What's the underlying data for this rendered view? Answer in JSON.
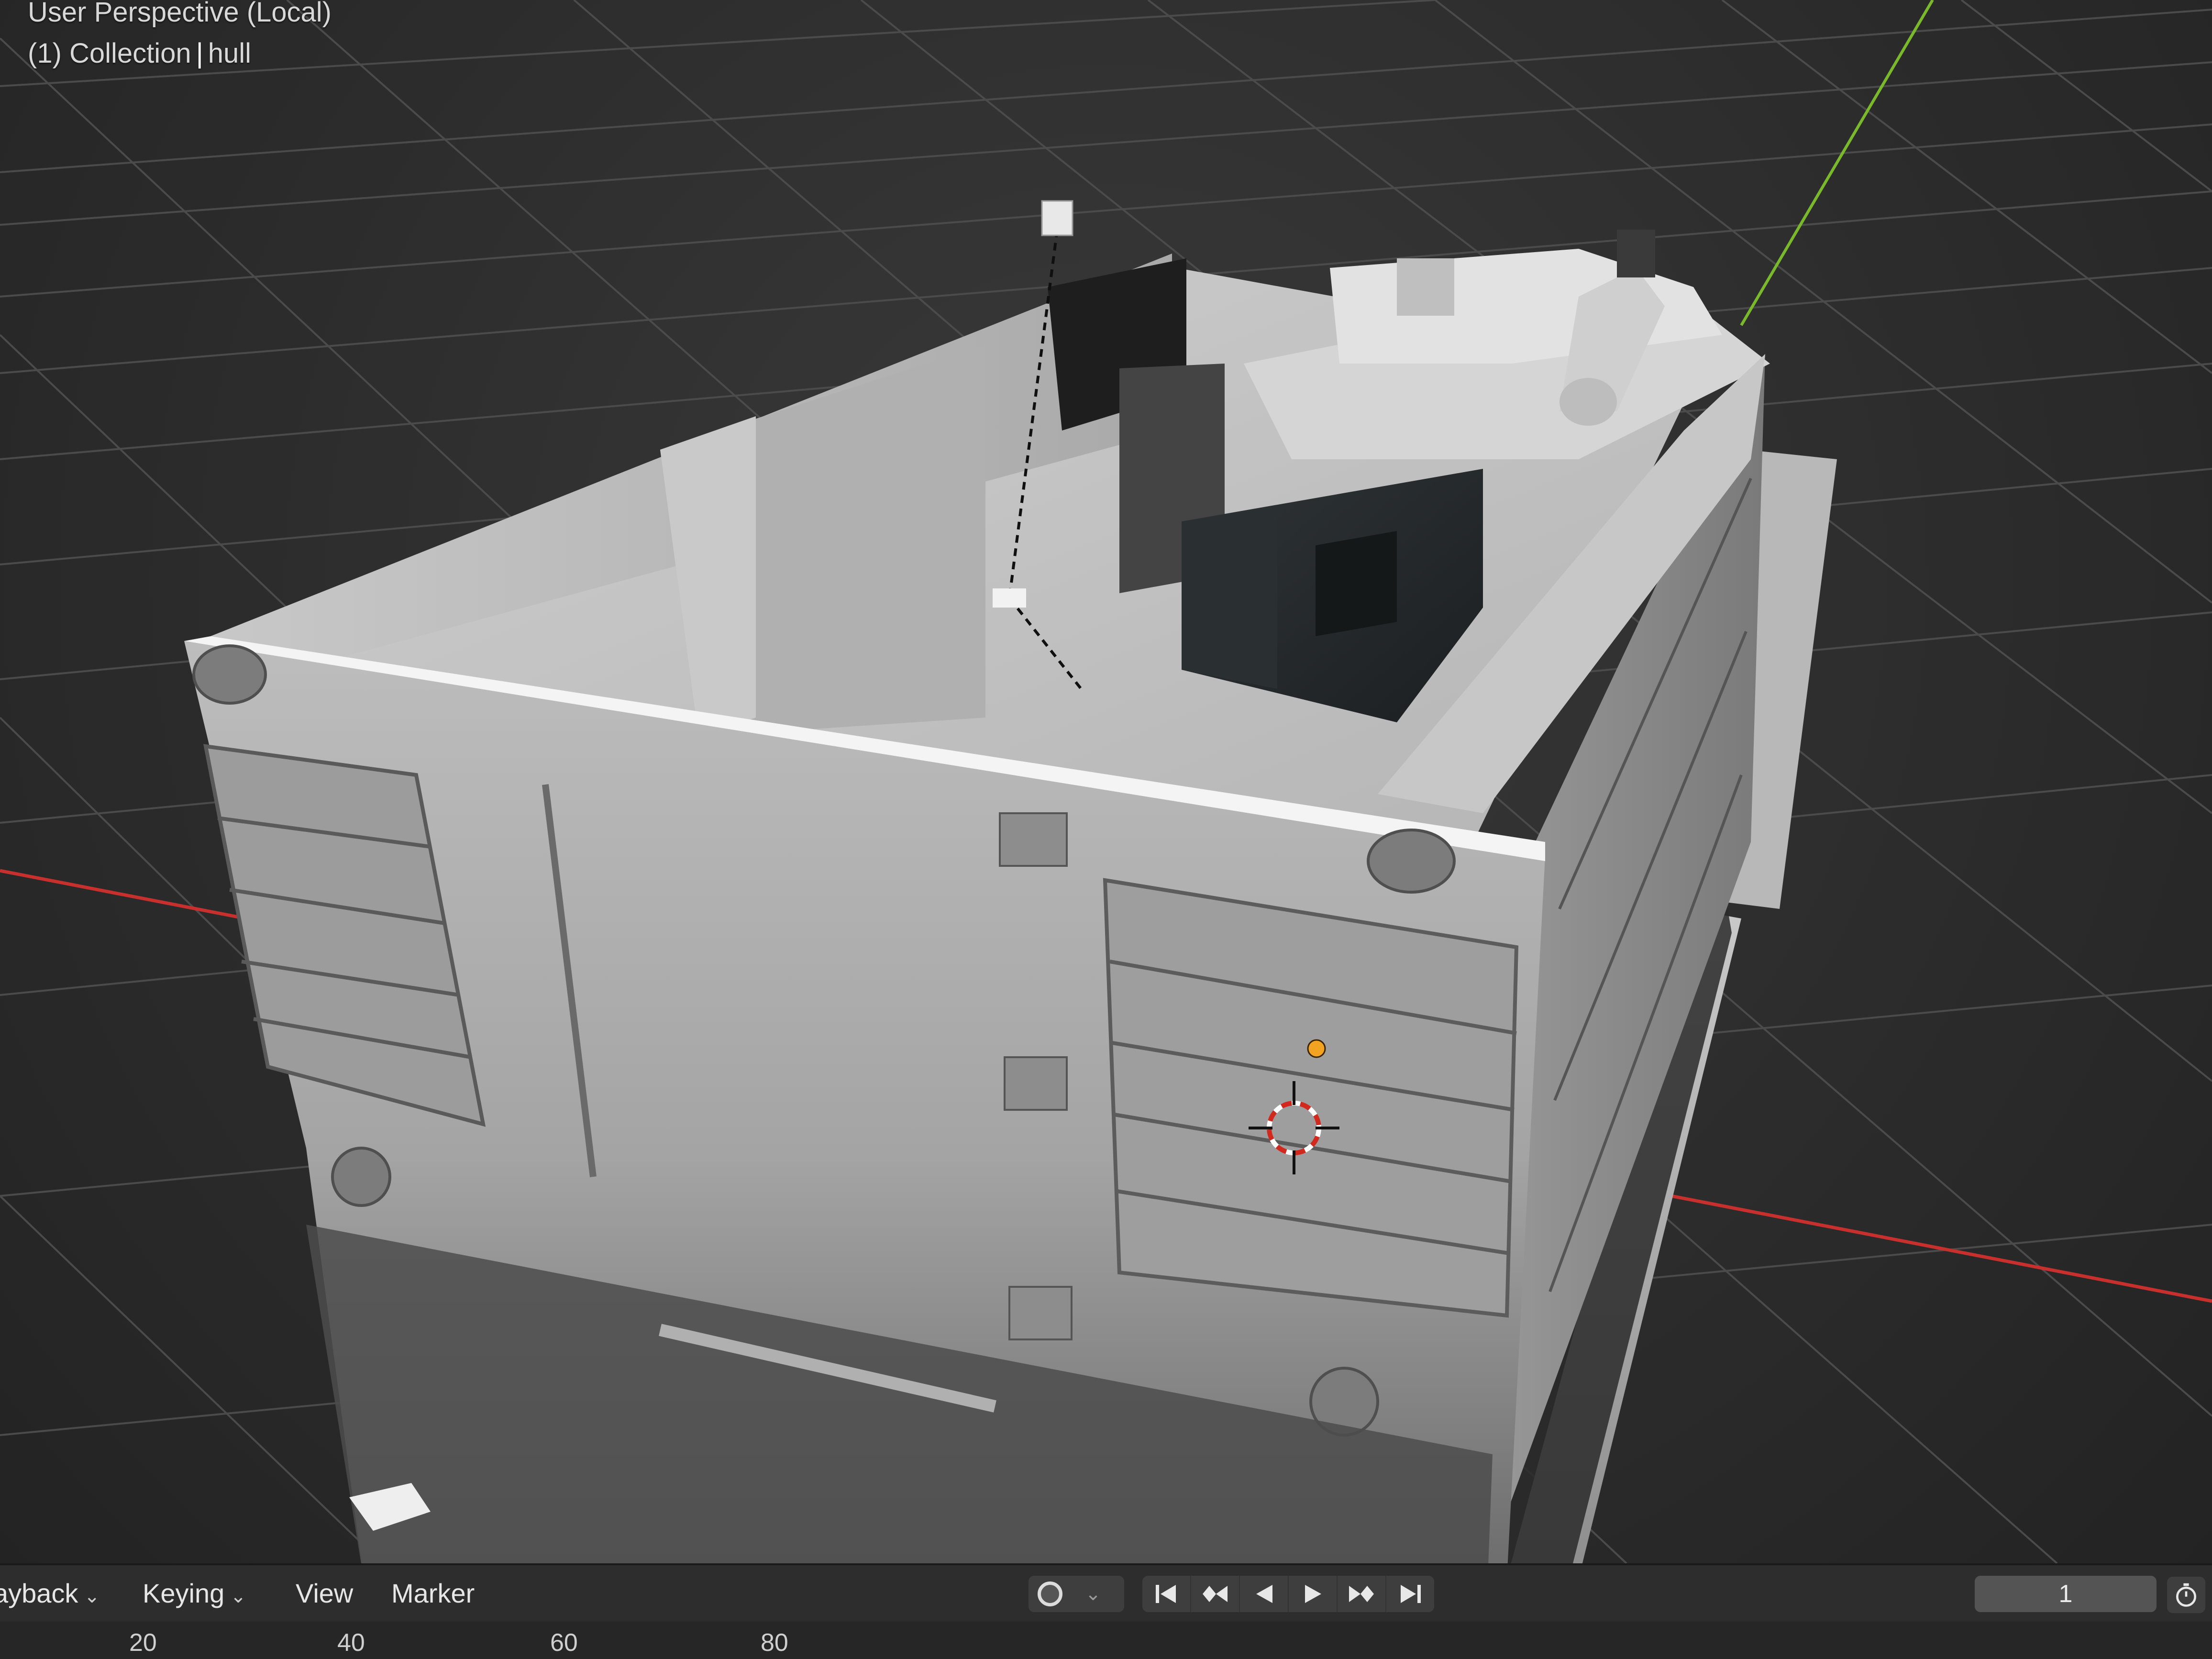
{
  "viewport": {
    "view_name": "User Perspective (Local)",
    "collection_label": "(1) Collection",
    "object_name": "hull"
  },
  "timeline": {
    "menus": [
      {
        "label": "ayback",
        "has_dropdown": true
      },
      {
        "label": "Keying",
        "has_dropdown": true
      },
      {
        "label": "View",
        "has_dropdown": false
      },
      {
        "label": "Marker",
        "has_dropdown": false
      }
    ],
    "transport_icons": [
      "jump-to-start-icon",
      "jump-to-keyframe-prev-icon",
      "play-reverse-icon",
      "play-icon",
      "jump-to-keyframe-next-icon",
      "jump-to-end-icon"
    ],
    "current_frame": "1",
    "ruler_ticks": [
      "20",
      "40",
      "60",
      "80"
    ]
  },
  "colors": {
    "x_axis": "#c8302e",
    "y_axis": "#7ab82c",
    "grid": "#4a4a4a",
    "background": "#2b2b2b",
    "origin_dot": "#f2a321"
  }
}
